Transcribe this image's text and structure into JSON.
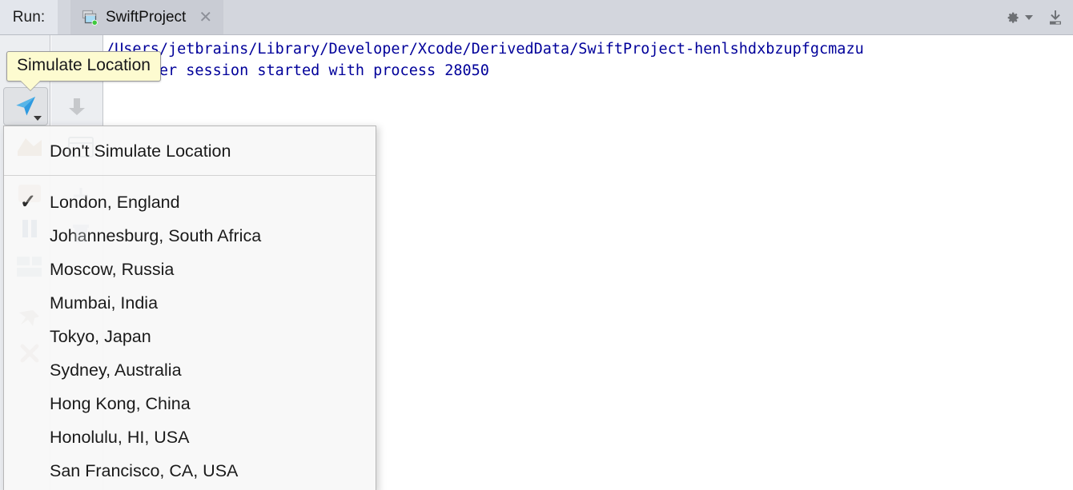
{
  "header": {
    "run_label": "Run:",
    "tab": {
      "title": "SwiftProject",
      "icon": "run-configuration-icon",
      "close_icon": "close-icon",
      "status": "running"
    },
    "actions": [
      {
        "name": "settings-gear",
        "icon": "gear-icon",
        "label": "⚙"
      },
      {
        "name": "scroll-to-end",
        "icon": "export-download-icon",
        "label": ""
      }
    ]
  },
  "toolbar": {
    "simulate_location_button": {
      "name": "simulate-location-button",
      "icon": "navigation-arrow-icon",
      "state": "pressed",
      "has_dropdown": true
    },
    "scroll_down_button": {
      "name": "scroll-down-button",
      "icon": "arrow-down-icon"
    }
  },
  "tooltip": {
    "text": "Simulate Location"
  },
  "console": {
    "lines": [
      "/Users/jetbrains/Library/Developer/Xcode/DerivedData/SwiftProject-henlshdxbzupfgcmazu",
      "Debugger session started with process 28050"
    ]
  },
  "menu": {
    "name": "simulate-location-menu",
    "top_items": [
      {
        "label": "Don't Simulate Location",
        "checked": false
      }
    ],
    "location_items": [
      {
        "label": "London, England",
        "checked": true
      },
      {
        "label": "Johannesburg, South Africa",
        "checked": false
      },
      {
        "label": "Moscow, Russia",
        "checked": false
      },
      {
        "label": "Mumbai, India",
        "checked": false
      },
      {
        "label": "Tokyo, Japan",
        "checked": false
      },
      {
        "label": "Sydney, Australia",
        "checked": false
      },
      {
        "label": "Hong Kong, China",
        "checked": false
      },
      {
        "label": "Honolulu, HI, USA",
        "checked": false
      },
      {
        "label": "San Francisco, CA, USA",
        "checked": false
      }
    ],
    "checkmark_glyph": "✓"
  },
  "colors": {
    "tabbar_bg": "#d3d6dd",
    "tab_selected_bg": "#c9ccd4",
    "run_label_bg": "#e3e6ec",
    "toolstrip_bg": "#eceef1",
    "console_bg": "#ffffff",
    "console_text": "#00009a",
    "tooltip_bg": "#fdfbd0",
    "menu_bg": "#f8f8f8",
    "accent_blue": "#2e9ae0",
    "running_green": "#3ec93e"
  }
}
